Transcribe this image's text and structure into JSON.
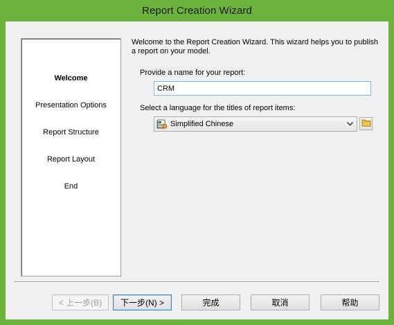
{
  "window": {
    "title": "Report Creation Wizard"
  },
  "steps": [
    {
      "label": "Welcome",
      "active": true
    },
    {
      "label": "Presentation Options",
      "active": false
    },
    {
      "label": "Report Structure",
      "active": false
    },
    {
      "label": "Report Layout",
      "active": false
    },
    {
      "label": "End",
      "active": false
    }
  ],
  "content": {
    "intro": "Welcome to the Report Creation Wizard. This wizard helps you to publish a report on your model.",
    "name_label": "Provide a name for your report:",
    "name_value": "CRM",
    "language_label": "Select a language for the titles of report items:",
    "language_selected": "Simplified Chinese"
  },
  "buttons": {
    "back": "< 上一步(B)",
    "next": "下一步(N) >",
    "finish": "完成",
    "cancel": "取消",
    "help": "帮助"
  },
  "icons": {
    "language": "language-flag-icon",
    "dropdown": "chevron-down-icon",
    "folder": "folder-icon"
  },
  "colors": {
    "title_bar": "#6cb33e",
    "client_background": "#f0f0f0",
    "input_focus_border": "#7eb4ea",
    "default_button_border": "#3c7fb1"
  }
}
